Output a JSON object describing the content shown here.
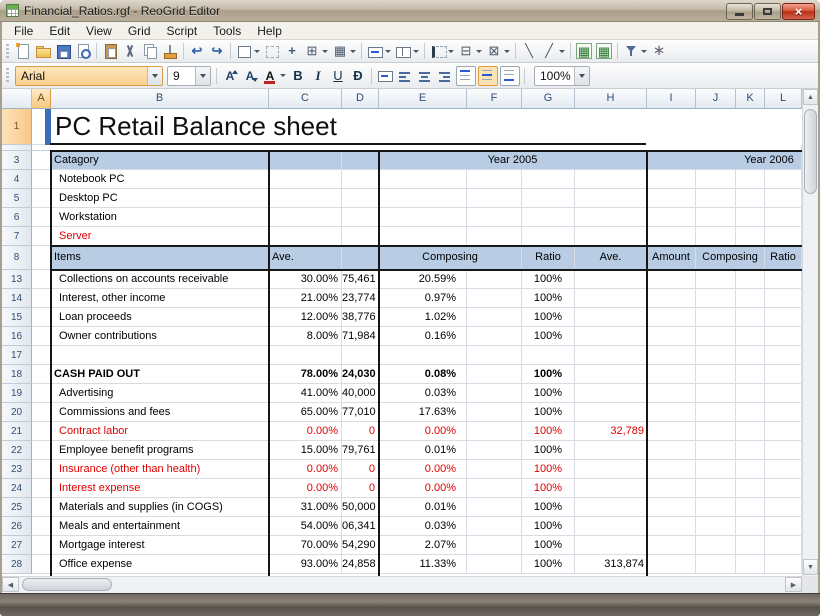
{
  "window": {
    "title": "Financial_Ratios.rgf - ReoGrid Editor",
    "close_glyph": "×"
  },
  "menu": {
    "items": [
      "File",
      "Edit",
      "View",
      "Grid",
      "Script",
      "Tools",
      "Help"
    ]
  },
  "toolbar_main": {
    "buttons": [
      {
        "name": "new-document-icon",
        "glyph": "",
        "dropdown": false
      },
      {
        "name": "open-icon",
        "glyph": "",
        "dropdown": false
      },
      {
        "name": "save-icon",
        "glyph": "",
        "dropdown": false
      },
      {
        "name": "print-preview-icon",
        "glyph": "",
        "dropdown": false
      },
      {
        "name": "separator"
      },
      {
        "name": "paste-icon",
        "glyph": "",
        "dropdown": false
      },
      {
        "name": "cut-icon",
        "glyph": "",
        "dropdown": false
      },
      {
        "name": "copy-icon",
        "glyph": "",
        "dropdown": false
      },
      {
        "name": "format-painter-icon",
        "glyph": "",
        "dropdown": false
      },
      {
        "name": "separator"
      },
      {
        "name": "undo-icon",
        "glyph": "↩",
        "dropdown": false
      },
      {
        "name": "redo-icon",
        "glyph": "↪",
        "dropdown": false
      },
      {
        "name": "separator"
      },
      {
        "name": "cell-style-icon",
        "glyph": "",
        "dropdown": true
      },
      {
        "name": "no-borders-icon",
        "glyph": "",
        "dropdown": false
      },
      {
        "name": "add-borders-icon",
        "glyph": "+",
        "dropdown": false
      },
      {
        "name": "outside-borders-icon",
        "glyph": "⊞",
        "dropdown": true
      },
      {
        "name": "grid-borders-icon",
        "glyph": "▦",
        "dropdown": true
      },
      {
        "name": "separator"
      },
      {
        "name": "merge-cells-icon",
        "glyph": "",
        "dropdown": true
      },
      {
        "name": "unmerge-cells-icon",
        "glyph": "",
        "dropdown": true
      },
      {
        "name": "separator"
      },
      {
        "name": "left-border-icon",
        "glyph": "",
        "dropdown": true
      },
      {
        "name": "inside-borders-icon",
        "glyph": "⊟",
        "dropdown": true
      },
      {
        "name": "clear-borders-icon",
        "glyph": "⊠",
        "dropdown": true
      },
      {
        "name": "separator"
      },
      {
        "name": "diagonal-down-icon",
        "glyph": "╲",
        "dropdown": false
      },
      {
        "name": "diagonal-up-icon",
        "glyph": "╱",
        "dropdown": true
      },
      {
        "name": "separator"
      },
      {
        "name": "freeze-panes-icon",
        "glyph": "▦",
        "dropdown": false
      },
      {
        "name": "unfreeze-panes-icon",
        "glyph": "▦",
        "dropdown": false
      },
      {
        "name": "separator"
      },
      {
        "name": "filter-icon",
        "glyph": "",
        "dropdown": true
      },
      {
        "name": "cell-format-icon",
        "glyph": "∗",
        "dropdown": false
      }
    ]
  },
  "toolbar_format": {
    "font_name": "Arial",
    "font_size": "9",
    "zoom": "100%",
    "buttons_font": [
      {
        "name": "increase-font-icon",
        "glyph": "A"
      },
      {
        "name": "decrease-font-icon",
        "glyph": "A"
      },
      {
        "name": "font-color-icon",
        "glyph": "A",
        "dropdown": true
      },
      {
        "name": "bold-icon",
        "glyph": "B"
      },
      {
        "name": "italic-icon",
        "glyph": "I"
      },
      {
        "name": "underline-icon",
        "glyph": "U"
      },
      {
        "name": "strikethrough-icon",
        "glyph": "Đ"
      }
    ],
    "buttons_align": [
      {
        "name": "merge-cells2-icon",
        "active": false
      },
      {
        "name": "align-left-icon",
        "active": false
      },
      {
        "name": "align-center-icon",
        "active": false
      },
      {
        "name": "align-right-icon",
        "active": false
      },
      {
        "name": "valign-top-icon",
        "active": false,
        "boxed": true
      },
      {
        "name": "valign-middle-icon",
        "active": true,
        "boxed": true
      },
      {
        "name": "valign-bottom-icon",
        "active": false,
        "boxed": true
      }
    ]
  },
  "colors": {
    "header_fill": "#b8cce4",
    "negative_text": "#e00000",
    "accent_fill": "#3b6cb5"
  },
  "scrollbars": {
    "up": "▲",
    "down": "▼",
    "left": "◀",
    "right": "▶"
  },
  "sheet": {
    "selected_column": "A",
    "columns": [
      "A",
      "B",
      "C",
      "D",
      "E",
      "F",
      "G",
      "H",
      "I",
      "J",
      "K",
      "L"
    ],
    "rows": [
      {
        "n": "1",
        "type": "title",
        "b": "PC Retail Balance sheet"
      },
      {
        "n": "",
        "type": "collapsed"
      },
      {
        "n": "3",
        "type": "yearhead",
        "b": "Catagory",
        "y2005": "Year 2005",
        "y2006": "Year 2006"
      },
      {
        "n": "4",
        "type": "cat",
        "b": "Notebook PC"
      },
      {
        "n": "5",
        "type": "cat",
        "b": "Desktop PC"
      },
      {
        "n": "6",
        "type": "cat",
        "b": "Workstation"
      },
      {
        "n": "7",
        "type": "cat",
        "b": "Server",
        "red": true
      },
      {
        "n": "8",
        "type": "colhead",
        "items": "Items",
        "ave": "Ave.",
        "composing": "Composing",
        "ratio": "Ratio",
        "ave2": "Ave.",
        "amount": "Amount",
        "composing2": "Composing",
        "ratio2": "Ratio"
      },
      {
        "n": "13",
        "type": "data",
        "b": "Collections on accounts receivable",
        "c": "30.00%",
        "d": "75,461",
        "e": "20.59%",
        "g": "100%"
      },
      {
        "n": "14",
        "type": "data",
        "b": "Interest, other income",
        "c": "21.00%",
        "d": "23,774",
        "e": "0.97%",
        "g": "100%"
      },
      {
        "n": "15",
        "type": "data",
        "b": "Loan proceeds",
        "c": "12.00%",
        "d": "38,776",
        "e": "1.02%",
        "g": "100%"
      },
      {
        "n": "16",
        "type": "data",
        "b": "Owner contributions",
        "c": "8.00%",
        "d": "71,984",
        "e": "0.16%",
        "g": "100%"
      },
      {
        "n": "17",
        "type": "data",
        "b": ""
      },
      {
        "n": "18",
        "type": "data",
        "b": "CASH PAID OUT",
        "c": "78.00%",
        "d": "24,030",
        "e": "0.08%",
        "g": "100%",
        "bold": true
      },
      {
        "n": "19",
        "type": "data",
        "b": "Advertising",
        "c": "41.00%",
        "d": "40,000",
        "e": "0.03%",
        "g": "100%"
      },
      {
        "n": "20",
        "type": "data",
        "b": "Commissions and fees",
        "c": "65.00%",
        "d": "77,010",
        "e": "17.63%",
        "g": "100%"
      },
      {
        "n": "21",
        "type": "data",
        "b": "Contract labor",
        "c": "0.00%",
        "d": "0",
        "e": "0.00%",
        "g": "100%",
        "h": "32,789",
        "red": true
      },
      {
        "n": "22",
        "type": "data",
        "b": "Employee benefit programs",
        "c": "15.00%",
        "d": "79,761",
        "e": "0.01%",
        "g": "100%"
      },
      {
        "n": "23",
        "type": "data",
        "b": "Insurance (other than health)",
        "c": "0.00%",
        "d": "0",
        "e": "0.00%",
        "g": "100%",
        "red": true
      },
      {
        "n": "24",
        "type": "data",
        "b": "Interest expense",
        "c": "0.00%",
        "d": "0",
        "e": "0.00%",
        "g": "100%",
        "red": true
      },
      {
        "n": "25",
        "type": "data",
        "b": "Materials and supplies (in COGS)",
        "c": "31.00%",
        "d": "50,000",
        "e": "0.01%",
        "g": "100%"
      },
      {
        "n": "26",
        "type": "data",
        "b": "Meals and entertainment",
        "c": "54.00%",
        "d": "06,341",
        "e": "0.03%",
        "g": "100%"
      },
      {
        "n": "27",
        "type": "data",
        "b": "Mortgage interest",
        "c": "70.00%",
        "d": "54,290",
        "e": "2.07%",
        "g": "100%"
      },
      {
        "n": "28",
        "type": "data",
        "b": "Office expense",
        "c": "93.00%",
        "d": "24,858",
        "e": "11.33%",
        "g": "100%",
        "h": "313,874"
      }
    ]
  }
}
